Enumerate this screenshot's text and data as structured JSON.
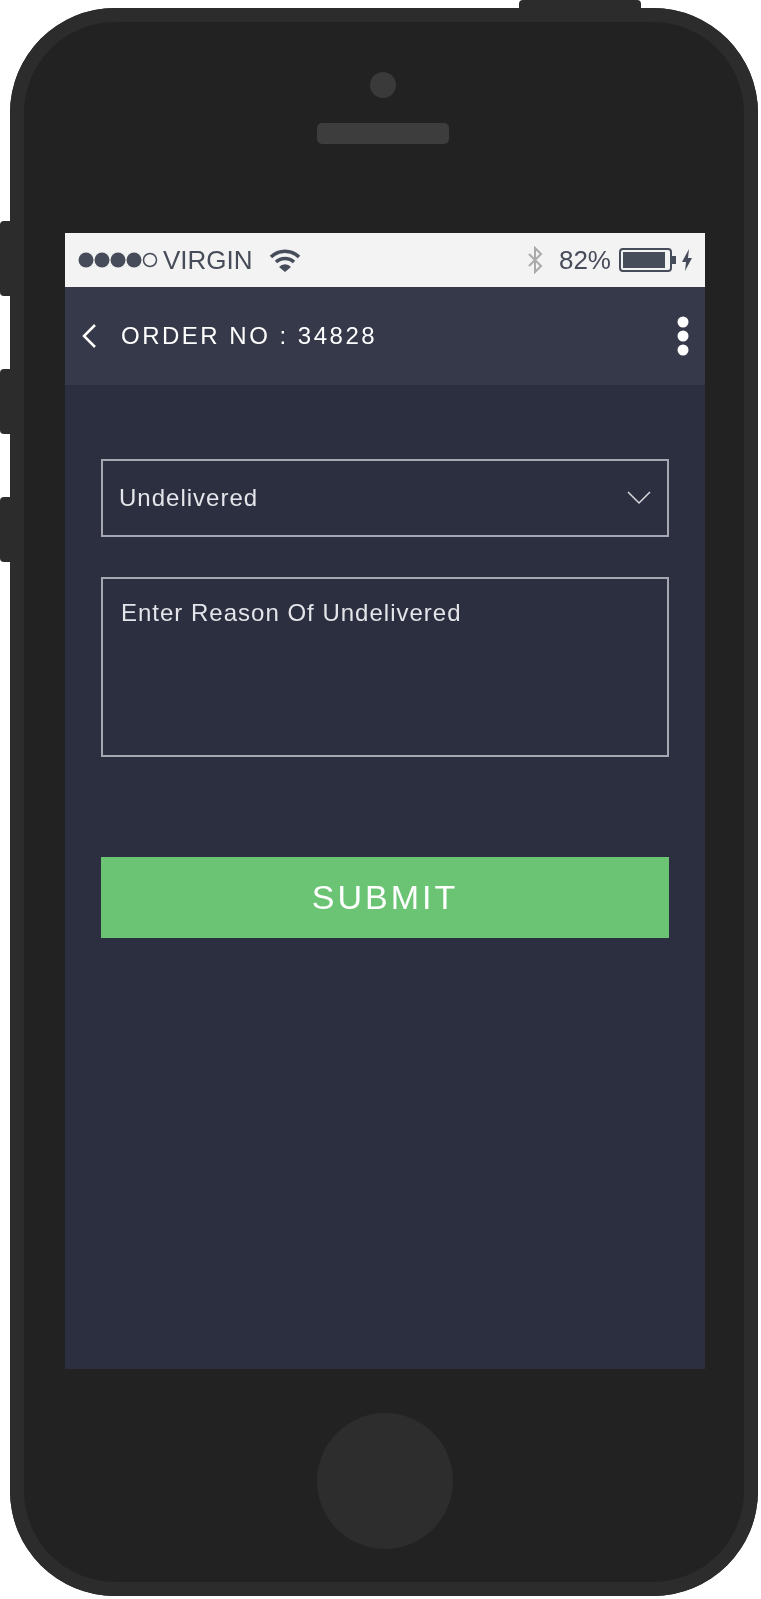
{
  "status_bar": {
    "carrier": "VIRGIN",
    "battery": "82%"
  },
  "header": {
    "title": "ORDER NO : 34828"
  },
  "form": {
    "status_select": {
      "value": "Undelivered"
    },
    "reason_field": {
      "placeholder": "Enter Reason Of Undelivered"
    },
    "submit_button": "SUBMIT"
  }
}
